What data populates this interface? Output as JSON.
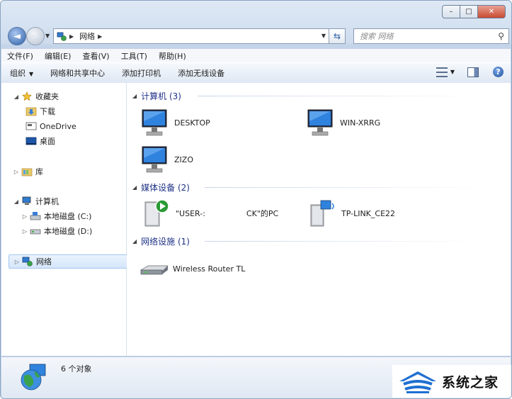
{
  "window": {
    "controls": {
      "minimize": "–",
      "maximize": "□",
      "close": "✕"
    }
  },
  "address": {
    "crumb": "网络",
    "search_placeholder": "搜索 网络"
  },
  "menu": [
    "文件(F)",
    "编辑(E)",
    "查看(V)",
    "工具(T)",
    "帮助(H)"
  ],
  "commands": {
    "organize": "组织",
    "network_center": "网络和共享中心",
    "add_printer": "添加打印机",
    "add_wireless": "添加无线设备"
  },
  "nav": {
    "favorites": "收藏夹",
    "downloads": "下载",
    "onedrive": "OneDrive",
    "desktop": "桌面",
    "libraries": "库",
    "computer": "计算机",
    "disk_c": "本地磁盘 (C:)",
    "disk_d": "本地磁盘 (D:)",
    "network": "网络"
  },
  "groups": {
    "computers": {
      "header": "计算机 (3)",
      "items": [
        "DESKTOP",
        "WIN-XRRG",
        "ZIZO"
      ]
    },
    "media": {
      "header": "媒体设备 (2)",
      "items": [
        "\"USER-:",
        "CK\"的PC",
        "TP-LINK_CE22"
      ]
    },
    "network_infra": {
      "header": "网络设施 (1)",
      "items": [
        "Wireless Router TL"
      ]
    }
  },
  "status": {
    "count": "6 个对象"
  },
  "watermark": {
    "text": "系统之家"
  }
}
